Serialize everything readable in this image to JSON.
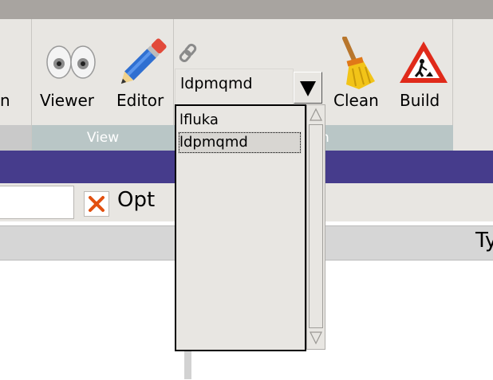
{
  "ribbon": {
    "partial_left_label": "n",
    "buttons": [
      {
        "label": "Viewer",
        "icon": "eyes-icon"
      },
      {
        "label": "Editor",
        "icon": "pencil-icon"
      },
      {
        "label": "Clean",
        "icon": "broom-icon"
      },
      {
        "label": "Build",
        "icon": "road-work-icon"
      }
    ],
    "groups": {
      "view_label": "View",
      "build_label_partial": "n"
    },
    "link_icon": "chain-link-icon"
  },
  "combobox": {
    "selected_value": "ldpmqmd",
    "options": [
      "lfluka",
      "ldpmqmd"
    ],
    "highlighted_index": 1
  },
  "options_bar": {
    "label_partial": "Opt",
    "clear_icon": "close-x-icon"
  },
  "table": {
    "header_partial": "Ty"
  },
  "colors": {
    "accent_bar": "#463c8c",
    "group_label_bg": "#b9c6c6",
    "ribbon_bg": "#e8e6e2"
  }
}
